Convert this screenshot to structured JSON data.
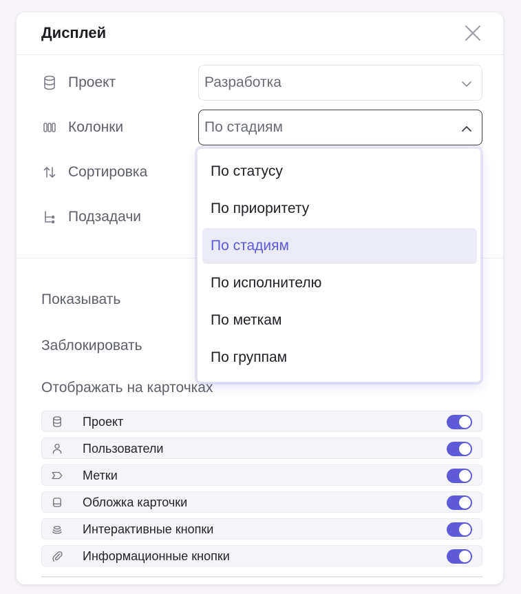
{
  "dialog": {
    "title": "Дисплей"
  },
  "settings": {
    "project": {
      "label": "Проект",
      "value": "Разработка"
    },
    "columns": {
      "label": "Колонки",
      "value": "По стадиям"
    },
    "sorting": {
      "label": "Сортировка"
    },
    "subtasks": {
      "label": "Подзадачи"
    }
  },
  "dropdown": {
    "options": [
      {
        "label": "По статусу"
      },
      {
        "label": "По приоритету"
      },
      {
        "label": "По стадиям",
        "selected": true
      },
      {
        "label": "По исполнителю"
      },
      {
        "label": "По меткам"
      },
      {
        "label": "По группам"
      }
    ]
  },
  "sections": {
    "show_label": "Показывать",
    "lock_label": "Заблокировать",
    "card_display_label": "Отображать на карточках"
  },
  "card_fields": [
    {
      "label": "Проект",
      "icon": "database-icon",
      "enabled": true
    },
    {
      "label": "Пользователи",
      "icon": "user-icon",
      "enabled": true
    },
    {
      "label": "Метки",
      "icon": "tag-icon",
      "enabled": true
    },
    {
      "label": "Обложка карточки",
      "icon": "card-cover-icon",
      "enabled": true
    },
    {
      "label": "Интерактивные кнопки",
      "icon": "stack-icon",
      "enabled": true
    },
    {
      "label": "Информационные кнопки",
      "icon": "paperclip-icon",
      "enabled": true
    }
  ],
  "colors": {
    "accent": "#5e5ad8",
    "selected_bg": "#ebebf7",
    "selected_text": "#5b59d6"
  }
}
